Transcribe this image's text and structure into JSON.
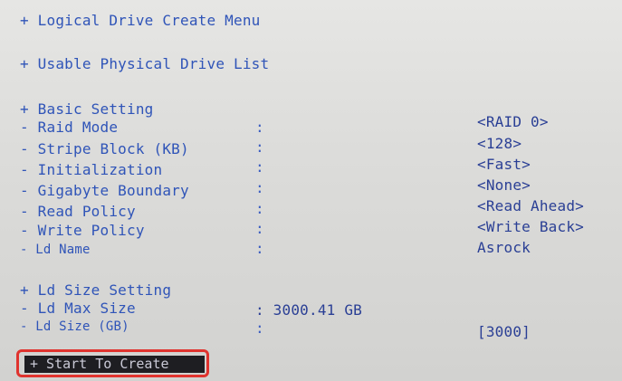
{
  "menu_title": "+ Logical Drive Create Menu",
  "usable_list": "+ Usable Physical Drive List",
  "basic_setting": {
    "header": "+ Basic Setting",
    "rows": [
      {
        "label": "- Raid Mode",
        "value": "<RAID 0>"
      },
      {
        "label": "- Stripe Block (KB)",
        "value": "<128>"
      },
      {
        "label": "- Initialization",
        "value": "<Fast>"
      },
      {
        "label": "- Gigabyte Boundary",
        "value": "<None>"
      },
      {
        "label": "- Read Policy",
        "value": "<Read Ahead>"
      },
      {
        "label": "- Write Policy",
        "value": "<Write Back>"
      },
      {
        "label": "- Ld Name",
        "value": "Asrock"
      }
    ]
  },
  "ld_size_setting": {
    "header": "+ Ld Size Setting",
    "max_label": "- Ld Max Size",
    "max_value": ": 3000.41 GB",
    "size_label": "- Ld Size (GB)",
    "size_value": "[3000]"
  },
  "separator": ":",
  "start_button": "+ Start To Create",
  "colors": {
    "highlight": "#e0332e",
    "text": "#2f54b8",
    "button_bg": "#1e1e22"
  }
}
